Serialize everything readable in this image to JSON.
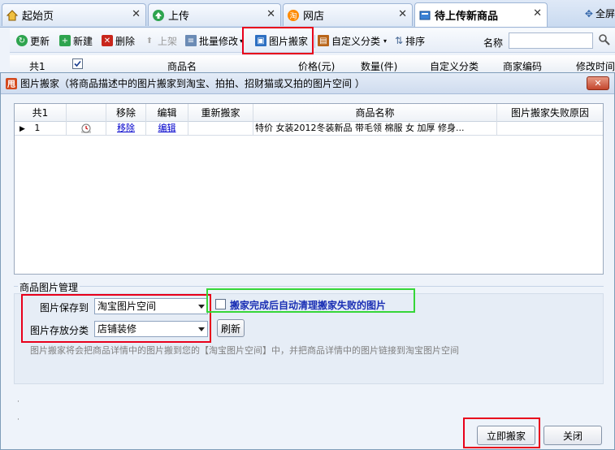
{
  "tabs": [
    {
      "label": "起始页",
      "icon": "home-icon",
      "active": false
    },
    {
      "label": "上传",
      "icon": "upload-icon",
      "active": false
    },
    {
      "label": "网店",
      "icon": "taobao-icon",
      "active": false
    },
    {
      "label": "待上传新商品",
      "icon": "products-icon",
      "active": true
    }
  ],
  "fullscreen_label": "全屏",
  "toolbar": {
    "refresh": "更新",
    "new": "新建",
    "delete": "删除",
    "list": "上架",
    "batch_edit": "批量修改",
    "image_move": "图片搬家",
    "custom_category": "自定义分类",
    "sort": "排序",
    "name_label": "名称"
  },
  "grid_header": {
    "count": "共1",
    "name": "商品名",
    "price": "价格(元)",
    "qty": "数量(件)",
    "custom_cat": "自定义分类",
    "seller_code": "商家编码",
    "modified": "修改时间"
  },
  "dialog": {
    "title": "图片搬家（将商品描述中的图片搬家到淘宝、拍拍、招财猫或又拍的图片空间 ）",
    "table": {
      "headers": {
        "count": "共1",
        "remove": "移除",
        "edit": "编辑",
        "remove_again": "重新搬家",
        "product_name": "商品名称",
        "fail_reason": "图片搬家失败原因"
      },
      "rows": [
        {
          "index": "1",
          "remove": "移除",
          "edit": "编辑",
          "product_name": "特价 女装2012冬装新品 带毛领 棉服 女 加厚 修身...",
          "fail_reason": ""
        }
      ]
    },
    "group_title": "商品图片管理",
    "save_to_label": "图片保存到",
    "save_to_value": "淘宝图片空间",
    "category_label": "图片存放分类",
    "category_value": "店铺装修",
    "refresh_button": "刷新",
    "auto_clean_label": "搬家完成后自动清理搬家失败的图片",
    "auto_clean_checked": false,
    "hint": "图片搬家将会把商品详情中的图片搬到您的【淘宝图片空间】中，并把商品详情中的图片链接到淘宝图片空间",
    "move_now_button": "立即搬家",
    "close_button": "关闭"
  },
  "colors": {
    "highlight_red": "#e8001b",
    "highlight_green": "#36d638",
    "link_blue": "#0000cc"
  }
}
